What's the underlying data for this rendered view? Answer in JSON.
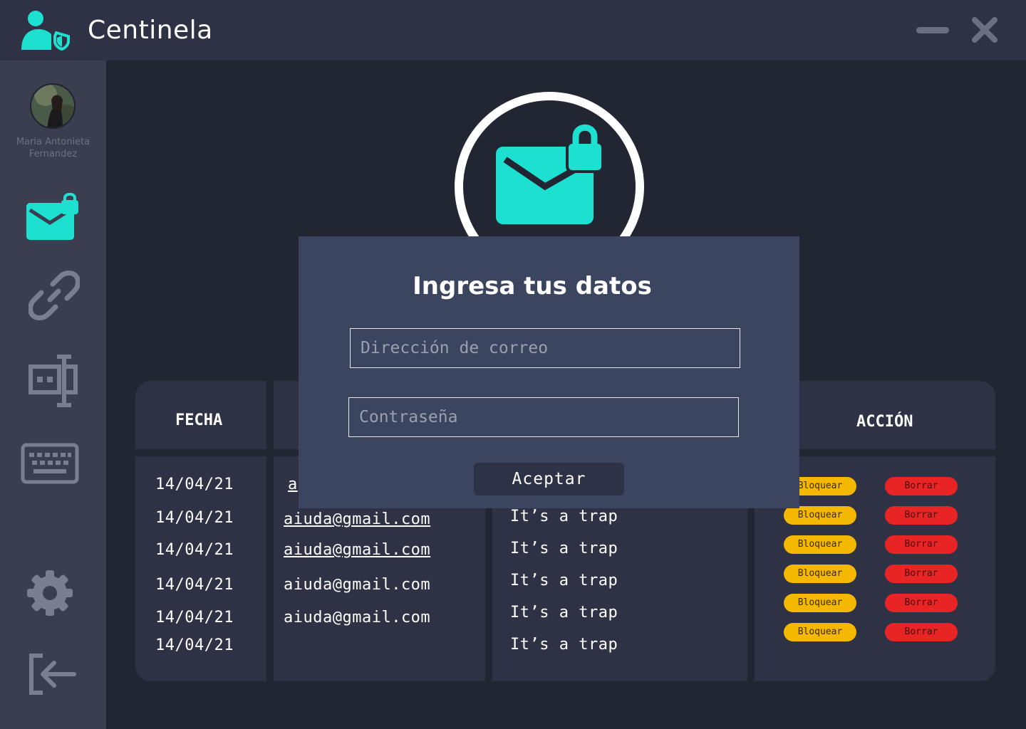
{
  "app": {
    "title": "Centinela"
  },
  "user": {
    "name": "Maria Antonieta Fernandez"
  },
  "colors": {
    "accent": "#1de0d0",
    "block": "#f5b800",
    "delete": "#e82424"
  },
  "sidebar": {
    "items": [
      {
        "icon": "mail-lock-icon"
      },
      {
        "icon": "link-icon"
      },
      {
        "icon": "network-icon"
      },
      {
        "icon": "keyboard-icon"
      },
      {
        "icon": "gear-icon"
      },
      {
        "icon": "logout-icon"
      }
    ]
  },
  "table": {
    "headers": {
      "fecha": "FECHA",
      "accion": "ACCIÓN"
    },
    "rows": [
      {
        "fecha": "14/04/21",
        "correo": "a",
        "asunto": "",
        "bloquear": "Bloquear",
        "borrar": "Borrar"
      },
      {
        "fecha": "14/04/21",
        "correo": "aiuda@gmail.com",
        "asunto": "It’s a trap",
        "bloquear": "Bloquear",
        "borrar": "Borrar"
      },
      {
        "fecha": "14/04/21",
        "correo": "aiuda@gmail.com",
        "asunto": "It’s a trap",
        "bloquear": "Bloquear",
        "borrar": "Borrar"
      },
      {
        "fecha": "14/04/21",
        "correo": "aiuda@gmail.com",
        "asunto": "It’s a trap",
        "bloquear": "Bloquear",
        "borrar": "Borrar"
      },
      {
        "fecha": "14/04/21",
        "correo": "aiuda@gmail.com",
        "asunto": "It’s a trap",
        "bloquear": "Bloquear",
        "borrar": "Borrar"
      },
      {
        "fecha": "14/04/21",
        "correo": "",
        "asunto": "It’s a trap",
        "bloquear": "Bloquear",
        "borrar": "Borrar"
      }
    ]
  },
  "modal": {
    "title": "Ingresa tus datos",
    "email_placeholder": "Dirección de correo",
    "password_placeholder": "Contraseña",
    "accept_label": "Aceptar"
  }
}
